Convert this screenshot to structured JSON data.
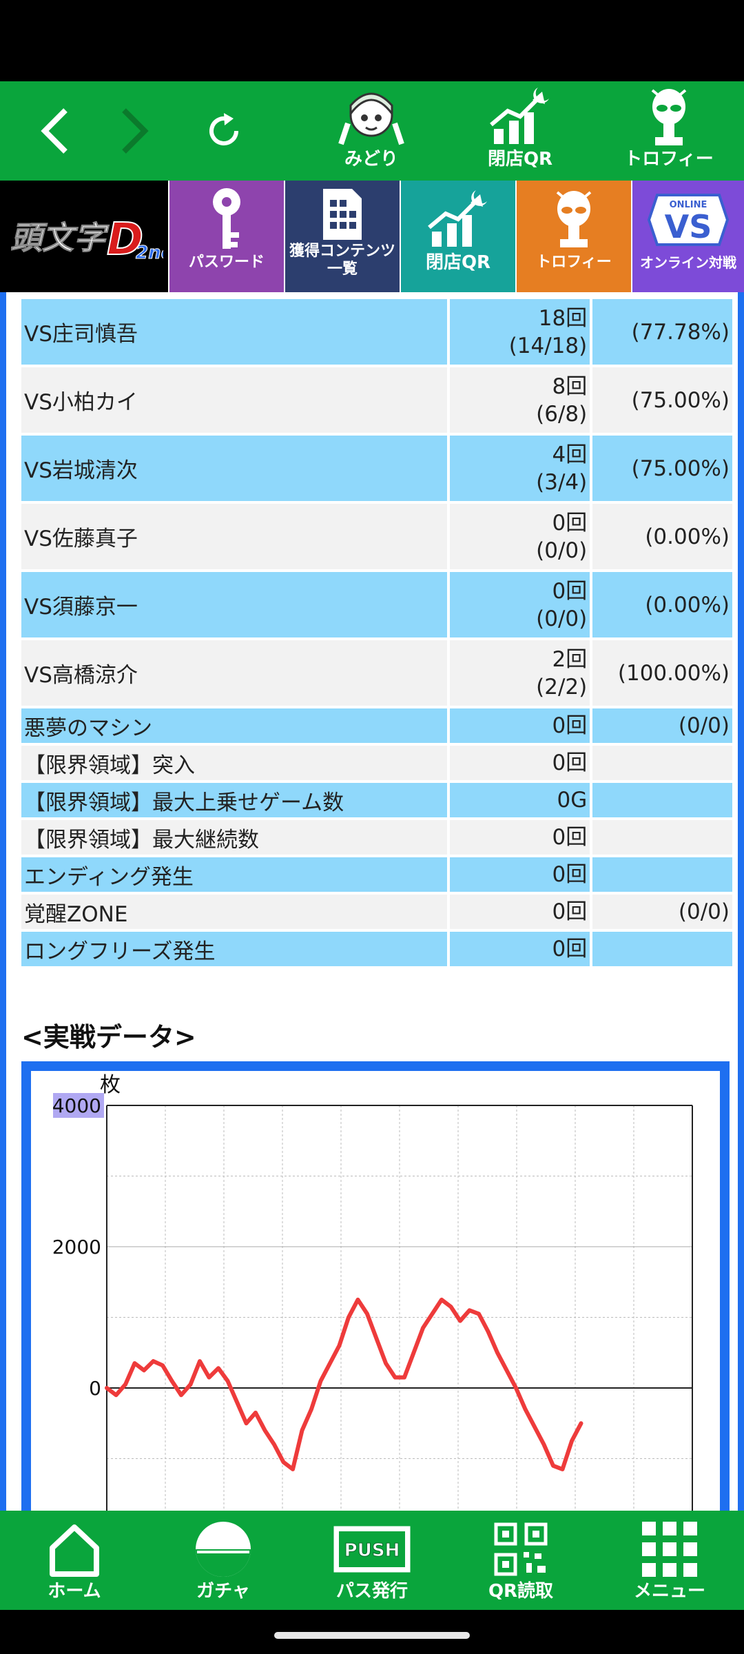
{
  "top_nav": {
    "back_label": "back",
    "forward_label": "forward",
    "items": [
      {
        "label": "みどり",
        "icon": "midori-character-icon"
      },
      {
        "label": "閉店QR",
        "icon": "chart-moon-icon"
      },
      {
        "label": "トロフィー",
        "icon": "alien-trophy-icon"
      }
    ]
  },
  "menu_strip": {
    "logo_text": "頭文字D 2nd",
    "tiles": [
      {
        "label": "パスワード",
        "color": "#8e44ad"
      },
      {
        "label1": "獲得コンテンツ",
        "label2": "一覧",
        "color": "#2c3e6e"
      },
      {
        "label": "閉店QR",
        "color": "#16a39a"
      },
      {
        "label": "トロフィー",
        "color": "#e67e22"
      },
      {
        "label": "オンライン対戦",
        "color": "#7d4bd8",
        "badge_small": "ONLINE",
        "badge_big": "VS"
      }
    ]
  },
  "stats_rows": [
    {
      "name": "VS庄司慎吾",
      "count": "18回",
      "ratio": "(14/18)",
      "pct": "(77.78%)"
    },
    {
      "name": "VS小柏カイ",
      "count": "8回",
      "ratio": "(6/8)",
      "pct": "(75.00%)"
    },
    {
      "name": "VS岩城清次",
      "count": "4回",
      "ratio": "(3/4)",
      "pct": "(75.00%)"
    },
    {
      "name": "VS佐藤真子",
      "count": "0回",
      "ratio": "(0/0)",
      "pct": "(0.00%)"
    },
    {
      "name": "VS須藤京一",
      "count": "0回",
      "ratio": "(0/0)",
      "pct": "(0.00%)"
    },
    {
      "name": "VS高橋涼介",
      "count": "2回",
      "ratio": "(2/2)",
      "pct": "(100.00%)"
    },
    {
      "name": "悪夢のマシン",
      "count": "0回",
      "ratio": "",
      "pct": "(0/0)"
    },
    {
      "name": "【限界領域】突入",
      "count": "0回",
      "ratio": "",
      "pct": ""
    },
    {
      "name": "【限界領域】最大上乗せゲーム数",
      "count": "0G",
      "ratio": "",
      "pct": ""
    },
    {
      "name": "【限界領域】最大継続数",
      "count": "0回",
      "ratio": "",
      "pct": ""
    },
    {
      "name": "エンディング発生",
      "count": "0回",
      "ratio": "",
      "pct": ""
    },
    {
      "name": "覚醒ZONE",
      "count": "0回",
      "ratio": "",
      "pct": "(0/0)"
    },
    {
      "name": "ロングフリーズ発生",
      "count": "0回",
      "ratio": "",
      "pct": ""
    }
  ],
  "section_title": "<実戦データ>",
  "chart_data": {
    "type": "line",
    "title": "",
    "ylabel": "枚",
    "xlabel": "",
    "ylim": [
      -1800,
      4000
    ],
    "y_ticks": [
      "4000",
      "2000",
      "0"
    ],
    "y_tick_values": [
      4000,
      2000,
      0
    ],
    "grid": true,
    "color": "#ee3b3b",
    "series": [
      {
        "values": [
          0,
          -100,
          50,
          350,
          250,
          380,
          320,
          100,
          -100,
          50,
          380,
          150,
          280,
          100,
          -200,
          -500,
          -350,
          -600,
          -800,
          -1050,
          -1150,
          -600,
          -300,
          100,
          350,
          600,
          1000,
          1250,
          1050,
          700,
          350,
          150,
          150,
          500,
          850,
          1050,
          1250,
          1150,
          950,
          1100,
          1050,
          800,
          500,
          250,
          0,
          -300,
          -550,
          -800,
          -1100,
          -1150,
          -750,
          -500
        ]
      }
    ]
  },
  "bottom_nav": [
    {
      "label": "ホーム",
      "icon": "home-icon"
    },
    {
      "label": "ガチャ",
      "icon": "gacha-capsule-icon"
    },
    {
      "label": "パス発行",
      "icon": "push-ticket-icon",
      "badge": "PUSH"
    },
    {
      "label": "QR読取",
      "icon": "qr-code-icon"
    },
    {
      "label": "メニュー",
      "icon": "grid-menu-icon"
    }
  ]
}
